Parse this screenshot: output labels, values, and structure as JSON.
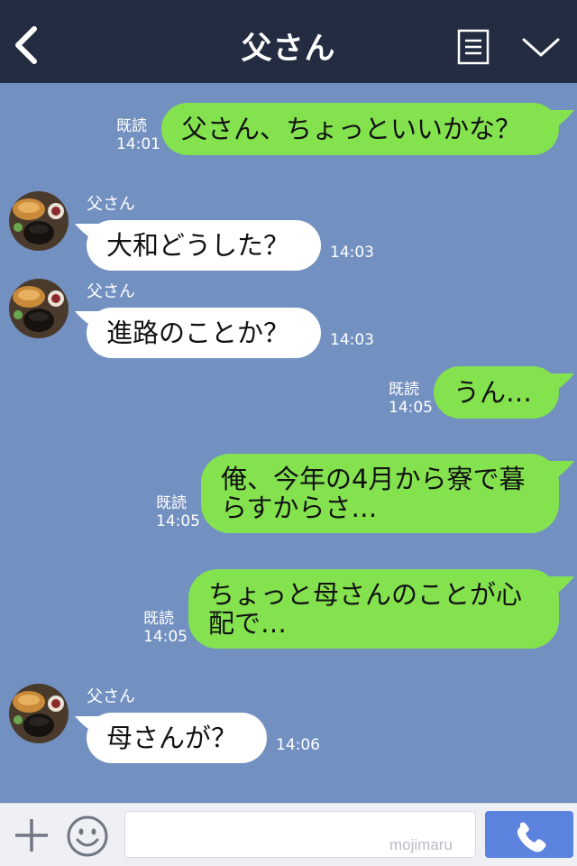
{
  "header": {
    "title": "父さん",
    "back_icon": "chevron-left-icon",
    "menu_icon": "list-icon",
    "collapse_icon": "chevron-down-icon"
  },
  "messages": [
    {
      "dir": "out",
      "text": "父さん、ちょっといいかな？",
      "read": "既読",
      "time": "14:01"
    },
    {
      "dir": "in",
      "sender": "父さん",
      "text": "大和どうした？",
      "time": "14:03"
    },
    {
      "dir": "in",
      "sender": "父さん",
      "text": "進路のことか？",
      "time": "14:03"
    },
    {
      "dir": "out",
      "text": "うん…",
      "read": "既読",
      "time": "14:05"
    },
    {
      "dir": "out",
      "lines": [
        "俺、今年の4月から寮で暮",
        "らすからさ…"
      ],
      "read": "既読",
      "time": "14:05"
    },
    {
      "dir": "out",
      "lines": [
        "ちょっと母さんのことが心",
        "配で…"
      ],
      "read": "既読",
      "time": "14:05"
    },
    {
      "dir": "in",
      "sender": "父さん",
      "text": "母さんが？",
      "time": "14:06"
    }
  ],
  "input_bar": {
    "plus_icon": "plus-icon",
    "emoji_icon": "smiley-icon",
    "input_value": "",
    "watermark": "mojimaru",
    "call_icon": "phone-icon"
  },
  "colors": {
    "header_bg": "#232c41",
    "chat_bg": "#7290c0",
    "outgoing_bubble": "#84e24f",
    "incoming_bubble": "#ffffff",
    "call_button": "#5b82dd"
  }
}
